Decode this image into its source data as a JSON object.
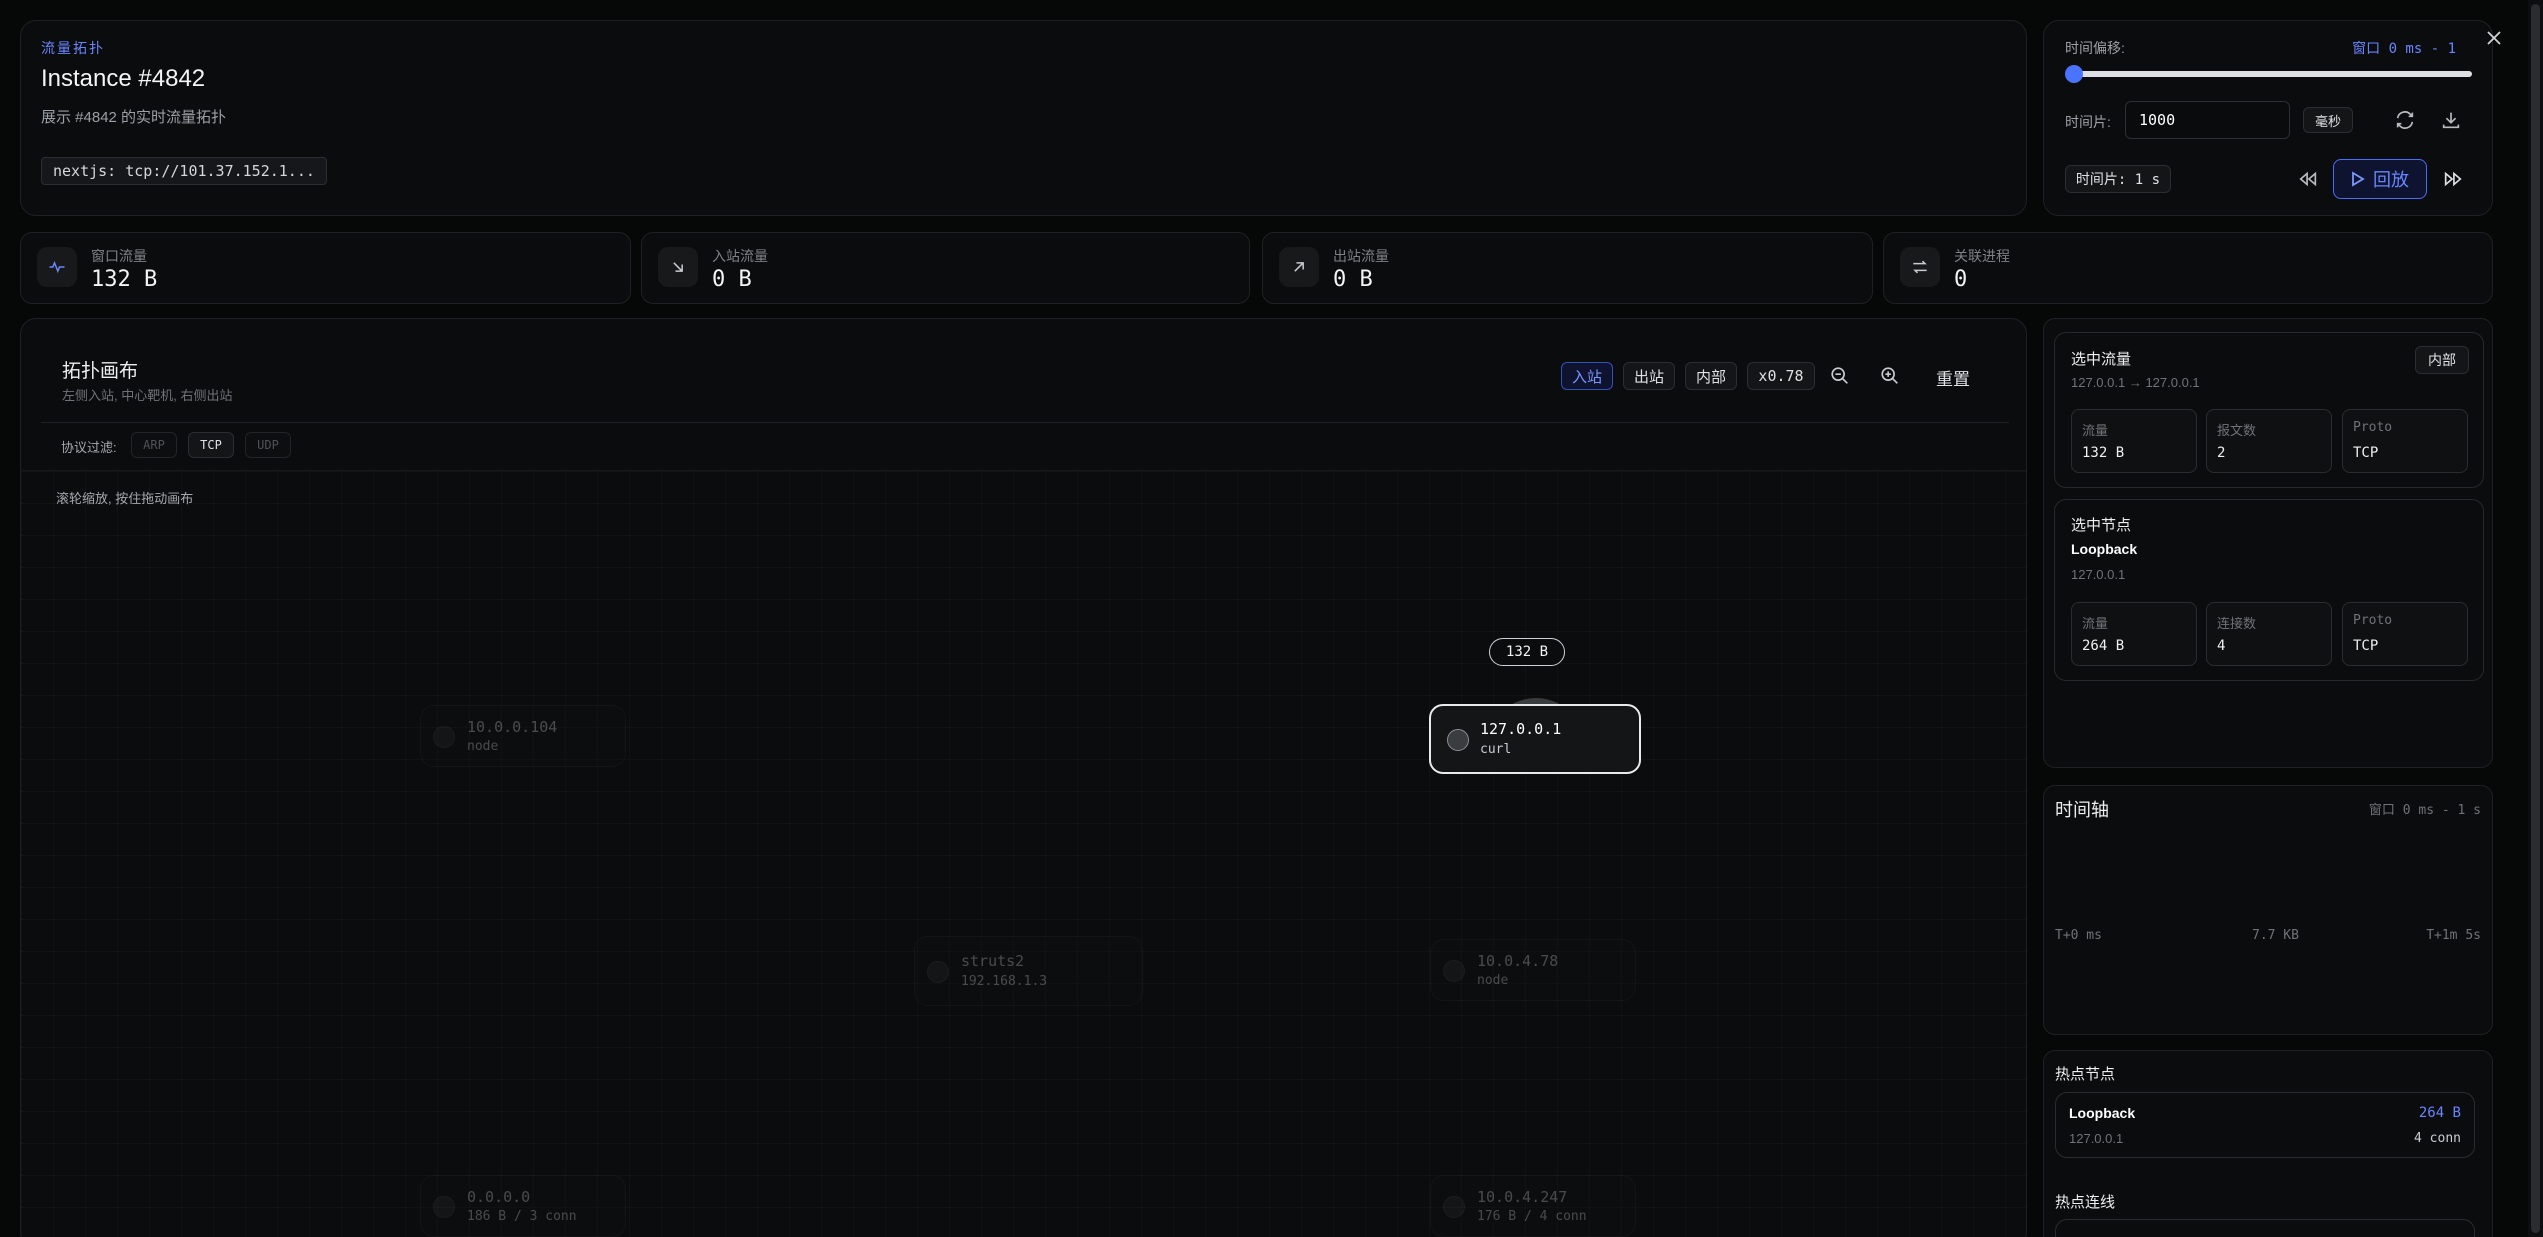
{
  "header": {
    "eyebrow": "流量拓扑",
    "title": "Instance #4842",
    "subtitle": "展示 #4842 的实时流量拓扑",
    "source_tag": "nextjs: tcp://101.37.152.1..."
  },
  "controls": {
    "offset_label": "时间偏移:",
    "window_text": "窗口 0 ms - 1",
    "slider_value": 0,
    "slice_label": "时间片:",
    "slice_value": "1000",
    "unit_label": "毫秒",
    "slice_badge": "时间片: 1 s",
    "replay_label": "回放"
  },
  "stats": [
    {
      "label": "窗口流量",
      "value": "132 B",
      "icon": "pulse-icon"
    },
    {
      "label": "入站流量",
      "value": "0 B",
      "icon": "arrow-down-right-icon"
    },
    {
      "label": "出站流量",
      "value": "0 B",
      "icon": "arrow-up-right-icon"
    },
    {
      "label": "关联进程",
      "value": "0",
      "icon": "swap-icon"
    }
  ],
  "canvas": {
    "title": "拓扑画布",
    "subtitle": "左侧入站, 中心靶机, 右侧出站",
    "filters": {
      "inbound": "入站",
      "outbound": "出站",
      "internal": "内部",
      "zoom": "x0.78",
      "reset": "重置"
    },
    "protocol_label": "协议过滤:",
    "protocols": [
      "ARP",
      "TCP",
      "UDP"
    ],
    "hint": "滚轮缩放, 按住拖动画布",
    "edge_label": "132 B",
    "nodes": [
      {
        "name": "127.0.0.1",
        "sub": "curl"
      },
      {
        "name": "10.0.0.104",
        "sub": "node"
      },
      {
        "name": "struts2",
        "sub": "192.168.1.3"
      },
      {
        "name": "10.0.4.78",
        "sub": "node"
      },
      {
        "name": "0.0.0.0",
        "sub": "186 B / 3 conn"
      },
      {
        "name": "10.0.4.247",
        "sub": "176 B / 4 conn"
      }
    ]
  },
  "selected_flow": {
    "title": "选中流量",
    "badge": "内部",
    "route": "127.0.0.1 → 127.0.0.1",
    "cells": [
      {
        "label": "流量",
        "value": "132 B"
      },
      {
        "label": "报文数",
        "value": "2"
      },
      {
        "label": "Proto",
        "value": "TCP"
      }
    ]
  },
  "selected_node": {
    "title": "选中节点",
    "name": "Loopback",
    "ip": "127.0.0.1",
    "cells": [
      {
        "label": "流量",
        "value": "264 B"
      },
      {
        "label": "连接数",
        "value": "4"
      },
      {
        "label": "Proto",
        "value": "TCP"
      }
    ]
  },
  "timeline": {
    "title": "时间轴",
    "window": "窗口 0 ms - 1 s",
    "start": "T+0 ms",
    "mid": "7.7 KB",
    "end": "T+1m 5s"
  },
  "hot_nodes": {
    "title": "热点节点",
    "items": [
      {
        "name": "Loopback",
        "value": "264 B",
        "ip": "127.0.0.1",
        "conn": "4 conn"
      }
    ]
  },
  "hot_links": {
    "title": "热点连线"
  },
  "colors": {
    "accent": "#6a86ff",
    "background": "#060707",
    "panel": "#0b0c0d"
  }
}
